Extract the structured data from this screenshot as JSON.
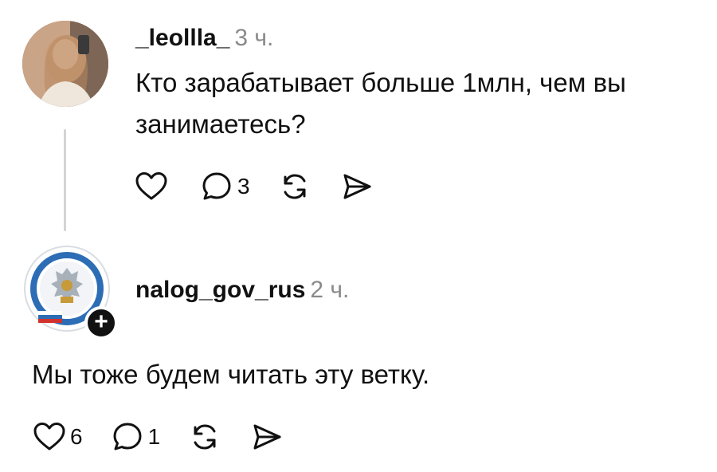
{
  "posts": [
    {
      "username": "_leollla_",
      "time": "3 ч.",
      "text": "Кто зарабатывает больше 1млн, чем вы занимаетесь?",
      "actions": {
        "like_count": "",
        "reply_count": "3",
        "repost_count": "",
        "share_count": ""
      },
      "avatar_icon": "profile-photo"
    },
    {
      "username": "nalog_gov_rus",
      "time": "2 ч.",
      "text": "Мы тоже будем читать эту ветку.",
      "actions": {
        "like_count": "6",
        "reply_count": "1",
        "repost_count": "",
        "share_count": ""
      },
      "avatar_icon": "fns-emblem",
      "follow_badge": "+"
    }
  ],
  "icons": {
    "like": "heart-icon",
    "reply": "comment-icon",
    "repost": "repost-icon",
    "share": "share-icon"
  }
}
